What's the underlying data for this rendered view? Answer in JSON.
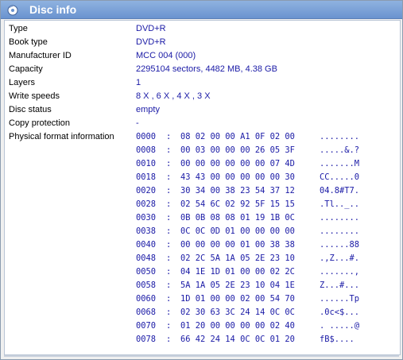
{
  "window": {
    "title": "Disc info",
    "icon": "disc-icon"
  },
  "properties": [
    {
      "label": "Type",
      "value": "DVD+R"
    },
    {
      "label": "Book type",
      "value": "DVD+R"
    },
    {
      "label": "Manufacturer ID",
      "value": "MCC 004 (000)"
    },
    {
      "label": "Capacity",
      "value": "2295104 sectors, 4482 MB, 4.38 GB"
    },
    {
      "label": "Layers",
      "value": "1"
    },
    {
      "label": "Write speeds",
      "value": "8 X , 6 X , 4 X , 3 X"
    },
    {
      "label": "Disc status",
      "value": "empty"
    },
    {
      "label": "Copy protection",
      "value": "-"
    }
  ],
  "physical_format": {
    "label": "Physical format information",
    "separator": ":",
    "lines": [
      {
        "offset": "0000",
        "bytes": "08 02 00 00 A1 0F 02 00",
        "ascii": "........"
      },
      {
        "offset": "0008",
        "bytes": "00 03 00 00 00 26 05 3F",
        "ascii": ".....&.?"
      },
      {
        "offset": "0010",
        "bytes": "00 00 00 00 00 00 07 4D",
        "ascii": ".......M"
      },
      {
        "offset": "0018",
        "bytes": "43 43 00 00 00 00 00 30",
        "ascii": "CC.....0"
      },
      {
        "offset": "0020",
        "bytes": "30 34 00 38 23 54 37 12",
        "ascii": "04.8#T7."
      },
      {
        "offset": "0028",
        "bytes": "02 54 6C 02 92 5F 15 15",
        "ascii": ".Tl.._.."
      },
      {
        "offset": "0030",
        "bytes": "0B 0B 08 08 01 19 1B 0C",
        "ascii": "........"
      },
      {
        "offset": "0038",
        "bytes": "0C 0C 0D 01 00 00 00 00",
        "ascii": "........"
      },
      {
        "offset": "0040",
        "bytes": "00 00 00 00 01 00 38 38",
        "ascii": "......88"
      },
      {
        "offset": "0048",
        "bytes": "02 2C 5A 1A 05 2E 23 10",
        "ascii": ".,Z...#."
      },
      {
        "offset": "0050",
        "bytes": "04 1E 1D 01 00 00 02 2C",
        "ascii": ".......,"
      },
      {
        "offset": "0058",
        "bytes": "5A 1A 05 2E 23 10 04 1E",
        "ascii": "Z...#..."
      },
      {
        "offset": "0060",
        "bytes": "1D 01 00 00 02 00 54 70",
        "ascii": "......Tp"
      },
      {
        "offset": "0068",
        "bytes": "02 30 63 3C 24 14 0C 0C",
        "ascii": ".0c<$..."
      },
      {
        "offset": "0070",
        "bytes": "01 20 00 00 00 00 02 40",
        "ascii": ". .....@"
      },
      {
        "offset": "0078",
        "bytes": "66 42 24 14 0C 0C 01 20",
        "ascii": "fB$...."
      }
    ]
  },
  "colors": {
    "title_bar": "#7ba1d8",
    "value_text": "#1a1aa6",
    "label_text": "#000000"
  }
}
